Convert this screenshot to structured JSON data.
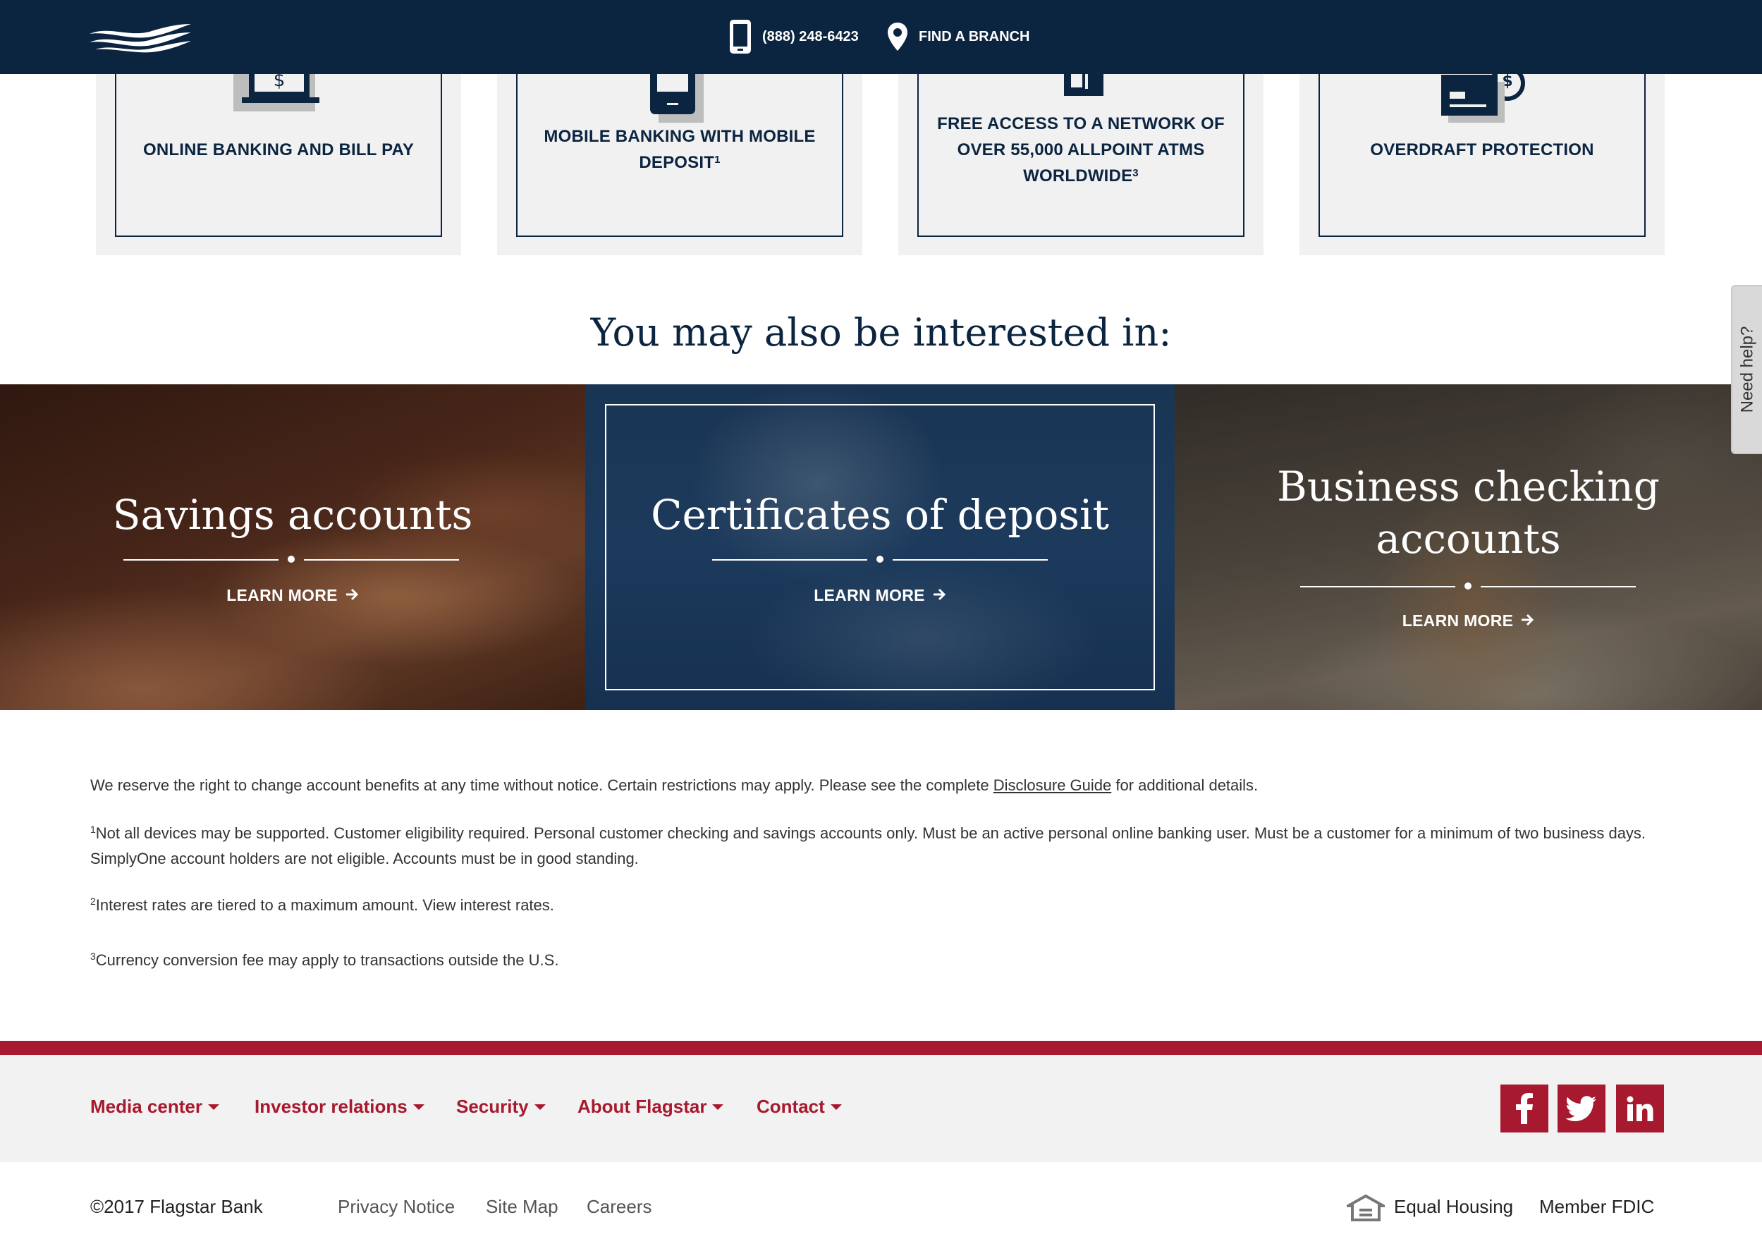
{
  "header": {
    "phone": "(888) 248-6423",
    "find_branch": "FIND A BRANCH"
  },
  "features": [
    {
      "text": "ONLINE BANKING AND BILL PAY",
      "icon": "laptop-dollar-icon"
    },
    {
      "text": "MOBILE BANKING WITH MOBILE DEPOSIT",
      "sup": "1",
      "icon": "mobile-phone-icon"
    },
    {
      "text": "FREE ACCESS TO A NETWORK OF OVER 55,000 ALLPOINT ATMS WORLDWIDE",
      "sup": "3",
      "icon": "atm-icon"
    },
    {
      "text": "OVERDRAFT PROTECTION",
      "icon": "card-dollar-icon"
    }
  ],
  "interested_heading": "You may also be interested in:",
  "promos": [
    {
      "title": "Savings accounts",
      "cta": "LEARN MORE"
    },
    {
      "title": "Certificates of deposit",
      "cta": "LEARN MORE"
    },
    {
      "title": "Business checking accounts",
      "cta": "LEARN MORE"
    }
  ],
  "help_tab": "Need help?",
  "disclosures": {
    "main_before": "We reserve the right to change account benefits at any time without notice. Certain restrictions may apply. Please see the complete ",
    "main_link": "Disclosure Guide",
    "main_after": " for additional details.",
    "note1_sup": "1",
    "note1": "Not all devices may be supported. Customer eligibility required.  Personal customer checking and savings accounts only.  Must be an active personal online banking user.  Must be a customer for a minimum of two business days.  SimplyOne account holders are not eligible.  Accounts must be in good standing.",
    "note2_sup": "2",
    "note2": "Interest rates are tiered to a maximum amount. View interest rates.",
    "note3_sup": "3",
    "note3": "Currency conversion fee may apply to transactions outside the U.S."
  },
  "footer_nav": [
    "Media center",
    "Investor relations",
    "Security",
    "About Flagstar",
    "Contact"
  ],
  "social": [
    "facebook-icon",
    "twitter-icon",
    "linkedin-icon"
  ],
  "bottom": {
    "copyright": "©2017 Flagstar Bank",
    "links": [
      "Privacy Notice",
      "Site Map",
      "Careers"
    ],
    "equal_housing": "Equal Housing",
    "member_fdic": "Member FDIC"
  },
  "colors": {
    "navy": "#0b2440",
    "brand_red": "#a7192e",
    "card_bg": "#f1f1f1"
  }
}
